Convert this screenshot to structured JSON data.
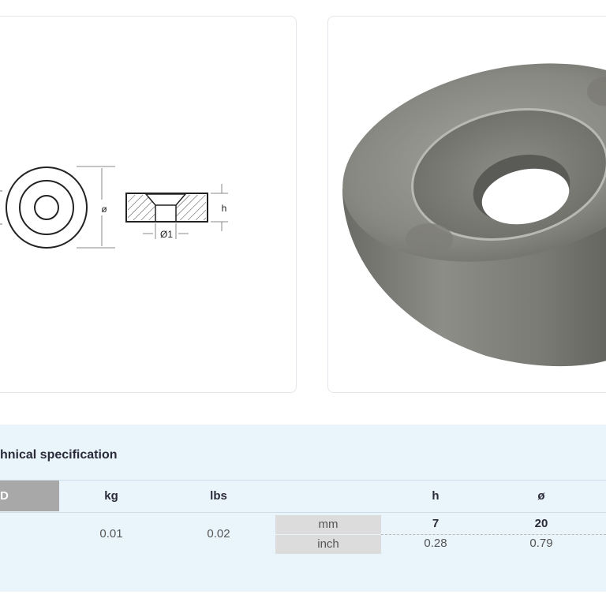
{
  "drawing": {
    "diameter_label": "ø",
    "height_label": "h",
    "inner_diameter_label": "Ø1"
  },
  "photo": {
    "alt": "zinc anode ring"
  },
  "specs": {
    "title": "hnical specification",
    "id_header": "D",
    "headers": {
      "kg": "kg",
      "lbs": "lbs",
      "h": "h",
      "diameter": "ø"
    },
    "weights": {
      "kg": "0.01",
      "lbs": "0.02"
    },
    "units": {
      "mm": "mm",
      "inch": "inch"
    },
    "mm_values": {
      "h": "7",
      "diameter": "20"
    },
    "inch_values": {
      "h": "0.28",
      "diameter": "0.79"
    }
  }
}
